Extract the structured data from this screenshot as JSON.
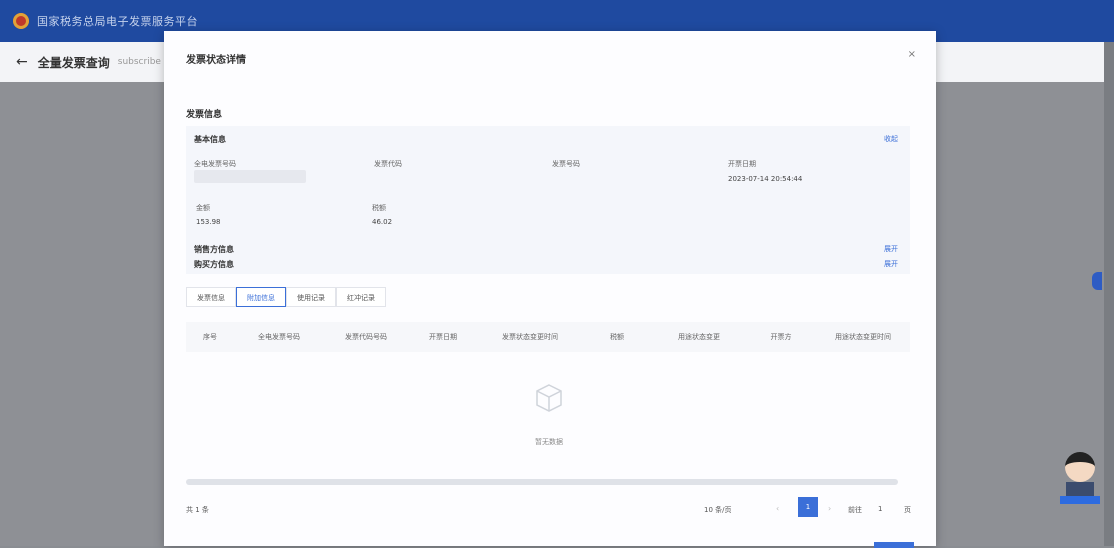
{
  "topbar": {
    "title": "国家税务总局电子发票服务平台"
  },
  "subbar": {
    "back_icon": "←",
    "title": "全量发票查询",
    "crumb": "subscribe"
  },
  "modal": {
    "title": "发票状态详情",
    "close": "×",
    "section_title": "发票信息",
    "basic": {
      "title": "基本信息",
      "toggle": "收起",
      "fields": [
        {
          "label": "全电发票号码",
          "value": ""
        },
        {
          "label": "发票代码",
          "value": ""
        },
        {
          "label": "发票号码",
          "value": ""
        },
        {
          "label": "开票日期",
          "value": "2023-07-14 20:54:44"
        },
        {
          "label": "金额",
          "value": "153.98"
        },
        {
          "label": "税额",
          "value": "46.02"
        }
      ]
    },
    "seller_title": "销售方信息",
    "seller_toggle": "展开",
    "buyer_title": "购买方信息",
    "buyer_toggle": "展开",
    "tabs": [
      "发票信息",
      "附加信息",
      "使用记录",
      "红冲记录"
    ],
    "columns": [
      "序号",
      "全电发票号码",
      "发票代码号码",
      "开票日期",
      "发票状态变更时间",
      "税额",
      "用途状态变更",
      "开票方",
      "用途状态变更时间"
    ],
    "empty_text": "暂无数据",
    "footer": {
      "total": "共 1 条",
      "page_size": "10 条/页",
      "prev": "‹",
      "page": "1",
      "next": "›",
      "goto_label": "前往",
      "goto_value": "1",
      "page_unit": "页"
    }
  }
}
